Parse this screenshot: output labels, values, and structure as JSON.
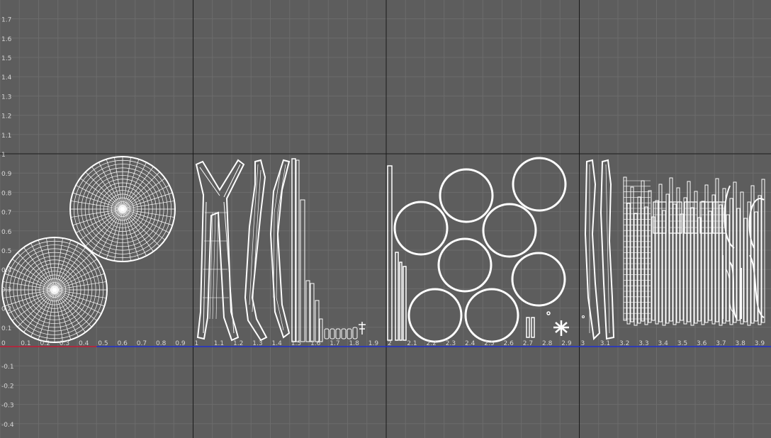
{
  "viewport": {
    "background": "#5d5d5d",
    "minor_grid_color": "#6c6c6c",
    "major_grid_color": "#1a1a1a",
    "u_axis_color": "#1f2fd0",
    "u_axis_highlight_color": "#d22222",
    "wireframe_color": "#ffffff",
    "u_tick_labels": [
      "0",
      "0.1",
      "0.2",
      "0.3",
      "0.4",
      "0.5",
      "0.6",
      "0.7",
      "0.8",
      "0.9",
      "1",
      "1.1",
      "1.2",
      "1.3",
      "1.4",
      "1.5",
      "1.6",
      "1.7",
      "1.8",
      "1.9",
      "2",
      "2.1",
      "2.2",
      "2.3",
      "2.4",
      "2.5",
      "2.6",
      "2.7",
      "2.8",
      "2.9",
      "3",
      "3.1",
      "3.2",
      "3.3",
      "3.4",
      "3.5",
      "3.6",
      "3.7",
      "3.8",
      "3.9"
    ],
    "v_tick_labels": [
      "1.7",
      "1.6",
      "1.5",
      "1.4",
      "1.3",
      "1.2",
      "1.1",
      "1",
      "0.9",
      "0.8",
      "0.7",
      "0.6",
      "0.5",
      "0.4",
      "0.3",
      "0.2",
      "0.1",
      "-0.1",
      "-0.2",
      "-0.3",
      "-0.4"
    ],
    "uv_tiles": [
      "0-1",
      "1-2",
      "2-3",
      "3-4"
    ]
  }
}
